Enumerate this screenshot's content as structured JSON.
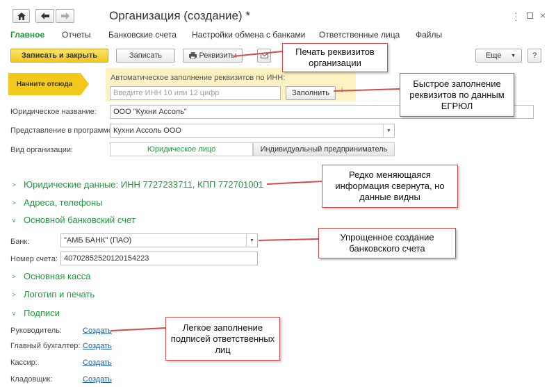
{
  "window": {
    "title": "Организация (создание) *",
    "home_icon": "home-icon",
    "back_icon": "arrow-left-icon",
    "forward_icon": "arrow-right-icon",
    "more_icon": "more-vertical-icon",
    "maximize_icon": "maximize-icon",
    "close_icon": "close-icon"
  },
  "nav": {
    "items": [
      "Главное",
      "Отчеты",
      "Банковские счета",
      "Настройки обмена с банками",
      "Ответственные лица",
      "Файлы"
    ]
  },
  "toolbar": {
    "save_close": "Записать и закрыть",
    "save": "Записать",
    "requisites": "Реквизиты",
    "more": "Еще",
    "help": "?"
  },
  "autofill": {
    "start_label": "Начните отсюда",
    "title": "Автоматическое заполнение реквизитов по ИНН:",
    "inn_placeholder": "Введите ИНН 10 или 12 цифр",
    "fill_button": "Заполнить",
    "fill_icon": "info-icon"
  },
  "form": {
    "legal_name_label": "Юридическое название:",
    "legal_name_value": "ООО \"Кухни Ассоль\"",
    "display_label": "Представление в программе:",
    "display_value": "Кухни Ассоль ООО",
    "org_type_label": "Вид организации:",
    "org_type_options": [
      "Юридическое лицо",
      "Индивидуальный предприниматель"
    ]
  },
  "sections": {
    "legal": "Юридические данные: ИНН 7727233711, КПП 772701001",
    "addresses": "Адреса, телефоны",
    "bank": "Основной банковский счет",
    "cash": "Основная касса",
    "logo": "Логотип и печать",
    "signatures": "Подписи"
  },
  "bank": {
    "bank_label": "Банк:",
    "bank_value": "\"АМБ БАНК\" (ПАО)",
    "account_label": "Номер счета:",
    "account_value": "40702852520120154223"
  },
  "signatures": {
    "rows": [
      {
        "label": "Руководитель:",
        "link": "Создать"
      },
      {
        "label": "Главный бухгалтер:",
        "link": "Создать"
      },
      {
        "label": "Кассир:",
        "link": "Создать"
      },
      {
        "label": "Кладовщик:",
        "link": "Создать"
      }
    ]
  },
  "callouts": {
    "print": "Печать реквизитов организации",
    "quick_fill": "Быстрое заполнение реквизитов по данным ЕГРЮЛ",
    "rarely": "Редко меняющаяся информация свернута, но данные видны",
    "bank_simple": "Упрощенное создание банковского счета",
    "signatures": "Легкое заполнение подписей ответственных лиц"
  },
  "colors": {
    "accent_green": "#1e9b3c",
    "primary_yellow": "#f3c81c",
    "autofill_bg": "#fdf2c4",
    "callout_border": "#d24a4a",
    "link_blue": "#1a5fb4"
  }
}
